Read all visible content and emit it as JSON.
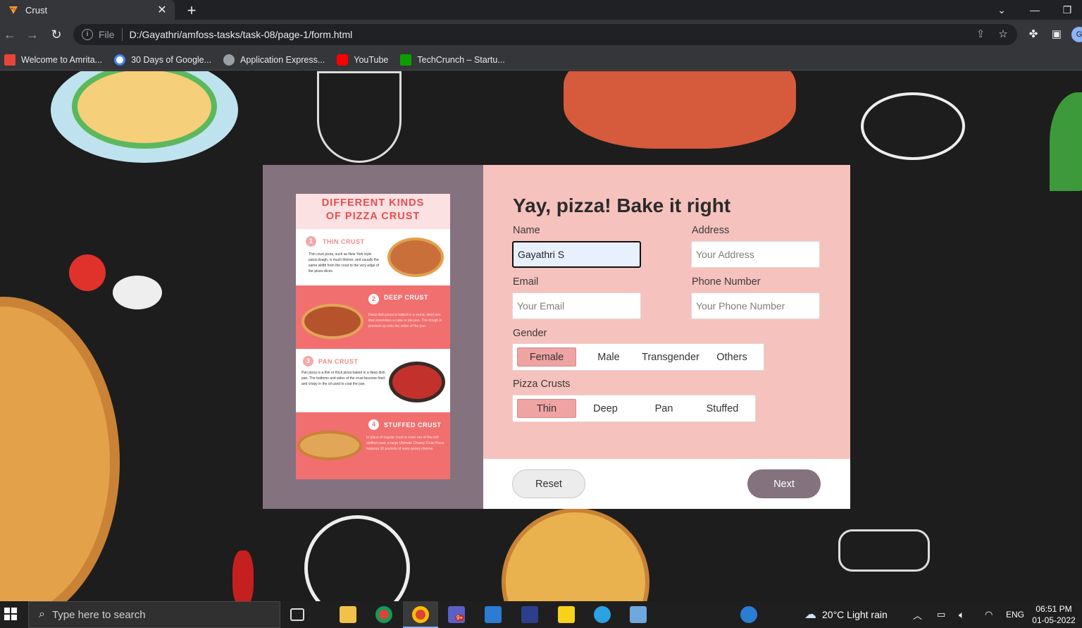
{
  "browser": {
    "tab_title": "Crust",
    "tab_close": "✕",
    "new_tab": "+",
    "address_prefix": "File",
    "address_url": "D:/Gayathri/amfoss-tasks/task-08/page-1/form.html",
    "profile_initial": "G",
    "bookmarks": [
      {
        "label": "Welcome to Amrita...",
        "color": "#e8443a"
      },
      {
        "label": "30 Days of Google...",
        "color": "#4285f4"
      },
      {
        "label": "Application Express...",
        "color": "#9aa0a6"
      },
      {
        "label": "YouTube",
        "color": "#ff0000"
      },
      {
        "label": "TechCrunch – Startu...",
        "color": "#0a9e01"
      }
    ]
  },
  "infographic": {
    "heading_line1": "DIFFERENT KINDS",
    "heading_line2": "OF PIZZA CRUST",
    "sections": [
      {
        "num": "1",
        "name": "THIN CRUST",
        "text": "Thin crust pizza, such as New York style pizza dough, is much thinner, and usually the same width from the crust to the very edge of the pizza slices."
      },
      {
        "num": "2",
        "name": "DEEP CRUST",
        "text": "Deep-dish pizza is baked in a round, steel pan that resembles a cake or pie pan. The dough is pressed up onto the sides of the pan."
      },
      {
        "num": "3",
        "name": "PAN CRUST",
        "text": "Pan pizza is a thin or thick pizza baked in a deep dish pan. The bottoms and sides of the crust become fried and crispy in the oil used to coat the pan."
      },
      {
        "num": "4",
        "name": "STUFFED CRUST",
        "text": "In place of regular crust or even run-of-the-mill stuffed crust, a large Ultimate Cheesy Crust Pizza features 16 pockets of ooey-gooey cheese."
      }
    ]
  },
  "form": {
    "title": "Yay, pizza! Bake it right",
    "name_label": "Name",
    "name_value": "Gayathri S",
    "address_label": "Address",
    "address_placeholder": "Your Address",
    "email_label": "Email",
    "email_placeholder": "Your Email",
    "phone_label": "Phone Number",
    "phone_placeholder": "Your Phone Number",
    "gender_label": "Gender",
    "gender_options": [
      "Female",
      "Male",
      "Transgender",
      "Others"
    ],
    "gender_selected": "Female",
    "crust_label": "Pizza Crusts",
    "crust_options": [
      "Thin",
      "Deep",
      "Pan",
      "Stuffed"
    ],
    "crust_selected": "Thin",
    "reset_label": "Reset",
    "next_label": "Next"
  },
  "taskbar": {
    "search_placeholder": "Type here to search",
    "weather": "20°C  Light rain",
    "language": "ENG",
    "time": "06:51 PM",
    "date": "01-05-2022",
    "teams_badge": "9+"
  }
}
